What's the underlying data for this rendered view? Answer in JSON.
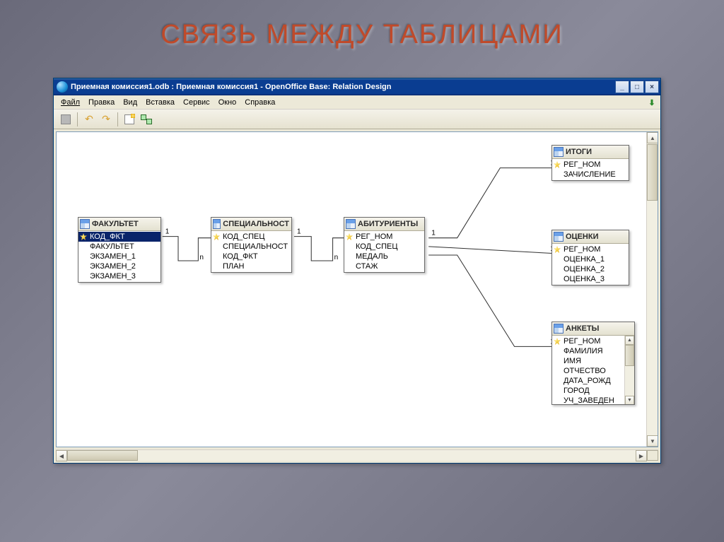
{
  "slide": {
    "title": "СВЯЗЬ МЕЖДУ ТАБЛИЦАМИ"
  },
  "window": {
    "title": "Приемная комиссия1.odb : Приемная комиссия1 - OpenOffice Base: Relation Design",
    "controls": {
      "min": "_",
      "max": "□",
      "close": "×"
    }
  },
  "menu": {
    "items": [
      "Файл",
      "Правка",
      "Вид",
      "Вставка",
      "Сервис",
      "Окно",
      "Справка"
    ]
  },
  "toolbar_icons": [
    "save",
    "undo",
    "redo",
    "sep",
    "new-table",
    "new-relation"
  ],
  "tables": {
    "fakultet": {
      "title": "ФАКУЛЬТЕТ",
      "fields": [
        {
          "name": "КОД_ФКТ",
          "pk": true,
          "selected": true
        },
        {
          "name": "ФАКУЛЬТЕТ"
        },
        {
          "name": "ЭКЗАМЕН_1"
        },
        {
          "name": "ЭКЗАМЕН_2"
        },
        {
          "name": "ЭКЗАМЕН_3"
        }
      ]
    },
    "specialnost": {
      "title": "СПЕЦИАЛЬНОСТ",
      "fields": [
        {
          "name": "КОД_СПЕЦ",
          "pk": true
        },
        {
          "name": "СПЕЦИАЛЬНОСТ"
        },
        {
          "name": "КОД_ФКТ"
        },
        {
          "name": "ПЛАН"
        }
      ]
    },
    "abiturienty": {
      "title": "АБИТУРИЕНТЫ",
      "fields": [
        {
          "name": "РЕГ_НОМ",
          "pk": true
        },
        {
          "name": "КОД_СПЕЦ"
        },
        {
          "name": "МЕДАЛЬ"
        },
        {
          "name": "СТАЖ"
        }
      ]
    },
    "itogi": {
      "title": "ИТОГИ",
      "fields": [
        {
          "name": "РЕГ_НОМ",
          "pk": true
        },
        {
          "name": "ЗАЧИСЛЕНИЕ"
        }
      ]
    },
    "ocenki": {
      "title": "ОЦЕНКИ",
      "fields": [
        {
          "name": "РЕГ_НОМ",
          "pk": true
        },
        {
          "name": "ОЦЕНКА_1"
        },
        {
          "name": "ОЦЕНКА_2"
        },
        {
          "name": "ОЦЕНКА_3"
        }
      ]
    },
    "ankety": {
      "title": "АНКЕТЫ",
      "fields": [
        {
          "name": "РЕГ_НОМ",
          "pk": true
        },
        {
          "name": "ФАМИЛИЯ"
        },
        {
          "name": "ИМЯ"
        },
        {
          "name": "ОТЧЕСТВО"
        },
        {
          "name": "ДАТА_РОЖД"
        },
        {
          "name": "ГОРОД"
        },
        {
          "name": "УЧ_ЗАВЕДЕН"
        }
      ]
    }
  },
  "relations": [
    {
      "from": "fakultet",
      "to": "specialnost",
      "card_from": "1",
      "card_to": "n"
    },
    {
      "from": "specialnost",
      "to": "abiturienty",
      "card_from": "1",
      "card_to": "n"
    },
    {
      "from": "abiturienty",
      "to": "itogi",
      "card_from": "1",
      "card_to": "1"
    },
    {
      "from": "abiturienty",
      "to": "ocenki",
      "card_from": "1",
      "card_to": "1"
    },
    {
      "from": "abiturienty",
      "to": "ankety",
      "card_from": "1",
      "card_to": "1"
    }
  ]
}
